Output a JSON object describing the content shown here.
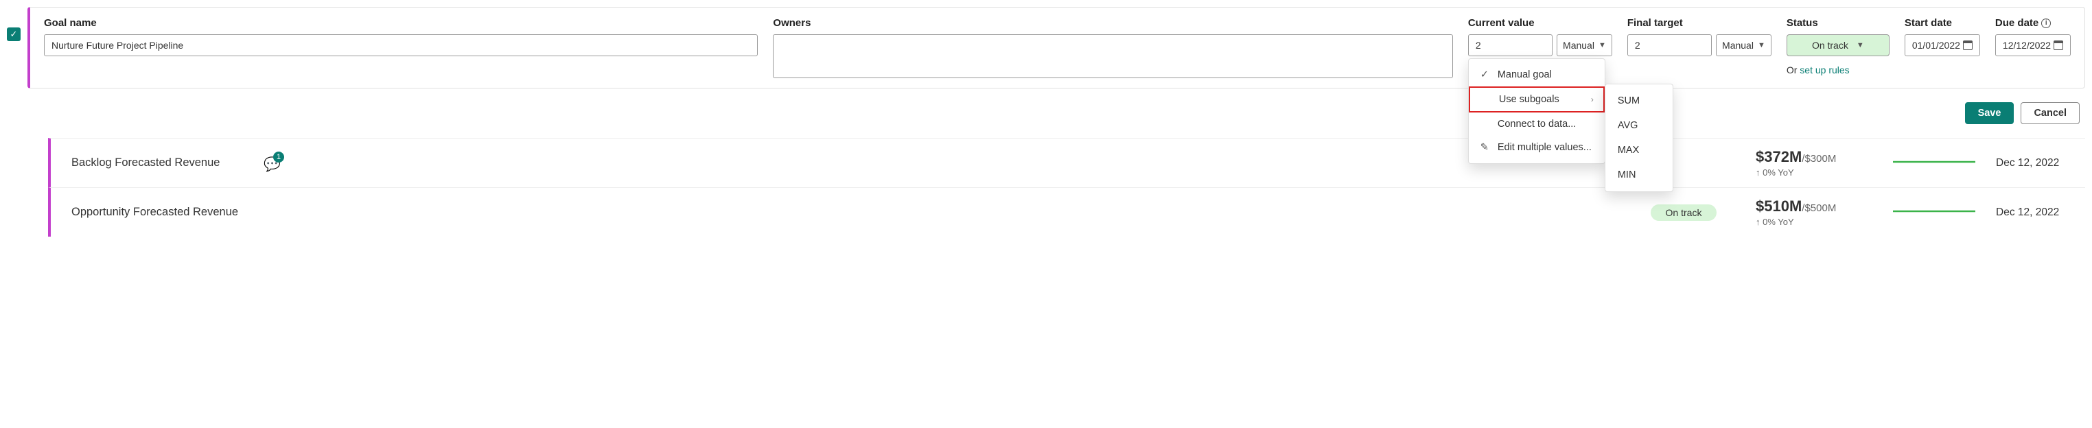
{
  "labels": {
    "goal_name": "Goal name",
    "owners": "Owners",
    "current_value": "Current value",
    "final_target": "Final target",
    "status": "Status",
    "start_date": "Start date",
    "due_date": "Due date"
  },
  "goal": {
    "name": "Nurture Future Project Pipeline",
    "owners": "",
    "current_value": "2",
    "current_value_mode": "Manual",
    "final_target": "2",
    "final_target_mode": "Manual",
    "status": "On track",
    "or_text": "Or ",
    "rules_link": "set up rules",
    "start_date": "01/01/2022",
    "due_date": "12/12/2022"
  },
  "dropdown": {
    "manual": "Manual goal",
    "subgoals": "Use subgoals",
    "connect": "Connect to data...",
    "edit": "Edit multiple values...",
    "agg": {
      "sum": "SUM",
      "avg": "AVG",
      "max": "MAX",
      "min": "MIN"
    }
  },
  "actions": {
    "save": "Save",
    "cancel": "Cancel"
  },
  "subgoals": [
    {
      "name": "Backlog Forecasted Revenue",
      "has_note": true,
      "note_count": "1",
      "status": "",
      "value": "$372M",
      "target": "/$300M",
      "yoy": "↑ 0% YoY",
      "date": "Dec 12, 2022",
      "spark_color": "#3bb34a"
    },
    {
      "name": "Opportunity Forecasted Revenue",
      "has_note": false,
      "status": "On track",
      "value": "$510M",
      "target": "/$500M",
      "yoy": "↑ 0% YoY",
      "date": "Dec 12, 2022",
      "spark_color": "#3bb34a"
    }
  ]
}
